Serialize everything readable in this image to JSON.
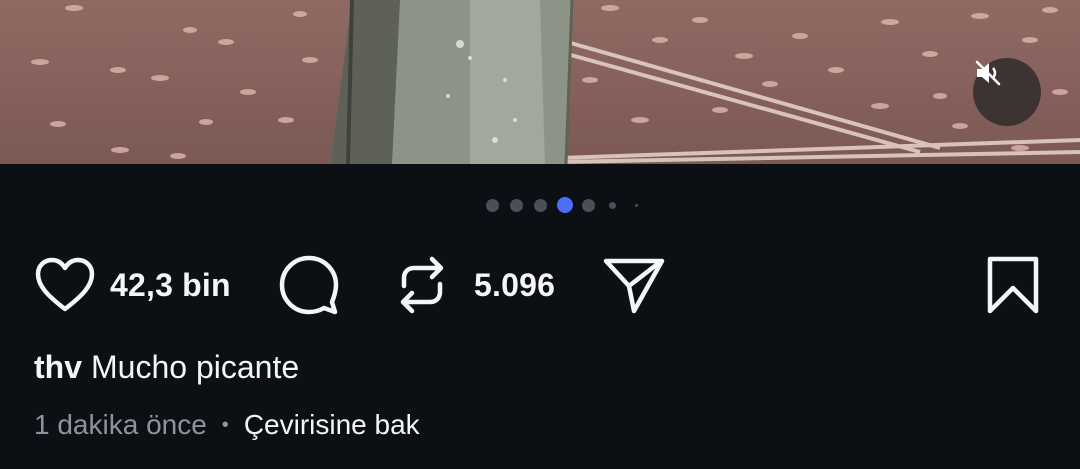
{
  "post": {
    "media": {
      "type": "video",
      "mute_icon": "speaker-muted-icon"
    },
    "carousel": {
      "count": 7,
      "active_index": 3,
      "active_color": "#4f6ef7",
      "inactive_color": "#4a5057"
    },
    "actions": {
      "like_icon": "heart-icon",
      "like_count": "42,3 bin",
      "comment_icon": "comment-bubble-icon",
      "repost_icon": "repost-icon",
      "repost_count": "5.096",
      "share_icon": "send-icon",
      "save_icon": "bookmark-icon"
    },
    "caption": {
      "username": "thv",
      "text": "Mucho picante"
    },
    "meta": {
      "time": "1 dakika önce",
      "separator": "•",
      "translate_label": "Çevirisine bak"
    }
  }
}
